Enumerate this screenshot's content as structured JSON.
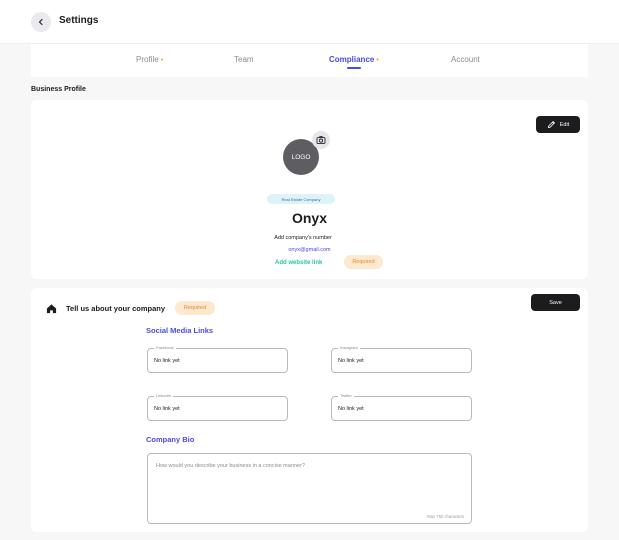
{
  "header": {
    "title": "Settings"
  },
  "tabs": [
    {
      "label": "Profile",
      "dot": "•",
      "active": false
    },
    {
      "label": "Team",
      "dot": "",
      "active": false
    },
    {
      "label": "Compliance",
      "dot": "•",
      "active": true
    },
    {
      "label": "Account",
      "dot": "",
      "active": false
    }
  ],
  "business_profile": {
    "section_title": "Business Profile",
    "edit_label": "Edit",
    "logo_text": "LOGO",
    "company_type": "Real Estate Company",
    "company_name": "Onyx",
    "company_number_placeholder": "Add company's number",
    "email": "onyx@gmail.com",
    "website_link": "Add website link",
    "required_badge": "Required"
  },
  "company_info": {
    "heading": "Tell us about your company",
    "required_badge": "Required",
    "save_label": "Save",
    "social_heading": "Social Media Links",
    "fields": [
      {
        "label": "Facebook",
        "value": "No link yet"
      },
      {
        "label": "Instagram",
        "value": "No link yet"
      },
      {
        "label": "LinkedIn",
        "value": "No link yet"
      },
      {
        "label": "Twitter",
        "value": "No link yet"
      }
    ],
    "bio_heading": "Company Bio",
    "bio_placeholder": "How would you describe your business in a concise manner?",
    "bio_limit": "Max 750 characters"
  },
  "colors": {
    "accent": "#4b4adf",
    "required_bg": "#fde8d0",
    "required_text": "#e08a2c",
    "link_green": "#27c4a0",
    "dark_button": "#1c1c1e",
    "tab_dot": "#f2a13a"
  },
  "icons": {
    "back": "chevron-left-icon",
    "camera": "camera-icon",
    "edit": "pencil-icon",
    "home": "home-icon"
  }
}
